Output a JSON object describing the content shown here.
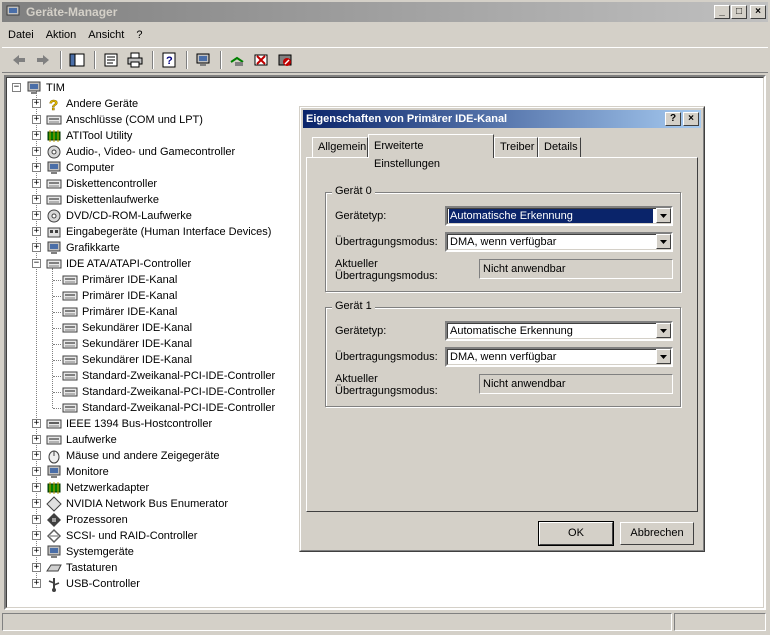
{
  "window": {
    "title": "Geräte-Manager",
    "minimize": "_",
    "maximize": "□",
    "close": "×"
  },
  "menu": [
    "Datei",
    "Aktion",
    "Ansicht",
    "?"
  ],
  "toolbar_icons": [
    "back-arrow-icon",
    "forward-arrow-icon",
    "console-tree-icon",
    "properties-icon",
    "print-icon",
    "help-icon",
    "computer-refresh-icon",
    "scan-hardware-icon",
    "update-driver-icon",
    "uninstall-icon",
    "disable-icon"
  ],
  "tree": {
    "root": "TIM",
    "items": [
      {
        "label": "Andere Geräte",
        "icon": "question-mark-icon",
        "expander": "+"
      },
      {
        "label": "Anschlüsse (COM und LPT)",
        "icon": "port-icon",
        "expander": "+"
      },
      {
        "label": "ATITool Utility",
        "icon": "chip-icon",
        "expander": "+"
      },
      {
        "label": "Audio-, Video- und Gamecontroller",
        "icon": "speaker-icon",
        "expander": "+"
      },
      {
        "label": "Computer",
        "icon": "computer-icon",
        "expander": "+"
      },
      {
        "label": "Diskettencontroller",
        "icon": "disk-controller-icon",
        "expander": "+"
      },
      {
        "label": "Diskettenlaufwerke",
        "icon": "floppy-icon",
        "expander": "+"
      },
      {
        "label": "DVD/CD-ROM-Laufwerke",
        "icon": "cdrom-icon",
        "expander": "+"
      },
      {
        "label": "Eingabegeräte (Human Interface Devices)",
        "icon": "hid-icon",
        "expander": "+"
      },
      {
        "label": "Grafikkarte",
        "icon": "display-icon",
        "expander": "+"
      },
      {
        "label": "IDE ATA/ATAPI-Controller",
        "icon": "ide-controller-icon",
        "expander": "-"
      }
    ],
    "ide_children": [
      "Primärer IDE-Kanal",
      "Primärer IDE-Kanal",
      "Primärer IDE-Kanal",
      "Sekundärer IDE-Kanal",
      "Sekundärer IDE-Kanal",
      "Sekundärer IDE-Kanal",
      "Standard-Zweikanal-PCI-IDE-Controller",
      "Standard-Zweikanal-PCI-IDE-Controller",
      "Standard-Zweikanal-PCI-IDE-Controller"
    ],
    "items_after": [
      {
        "label": "IEEE 1394 Bus-Hostcontroller",
        "icon": "firewire-icon",
        "expander": "+"
      },
      {
        "label": "Laufwerke",
        "icon": "hard-drive-icon",
        "expander": "+"
      },
      {
        "label": "Mäuse und andere Zeigegeräte",
        "icon": "mouse-icon",
        "expander": "+"
      },
      {
        "label": "Monitore",
        "icon": "monitor-icon",
        "expander": "+"
      },
      {
        "label": "Netzwerkadapter",
        "icon": "network-adapter-icon",
        "expander": "+"
      },
      {
        "label": "NVIDIA Network Bus Enumerator",
        "icon": "diamond-icon",
        "expander": "+"
      },
      {
        "label": "Prozessoren",
        "icon": "processor-icon",
        "expander": "+"
      },
      {
        "label": "SCSI- und RAID-Controller",
        "icon": "scsi-icon",
        "expander": "+"
      },
      {
        "label": "Systemgeräte",
        "icon": "system-device-icon",
        "expander": "+"
      },
      {
        "label": "Tastaturen",
        "icon": "keyboard-icon",
        "expander": "+"
      },
      {
        "label": "USB-Controller",
        "icon": "usb-icon",
        "expander": "+"
      }
    ]
  },
  "dialog": {
    "title": "Eigenschaften von Primärer IDE-Kanal",
    "help_btn": "?",
    "close_btn": "×",
    "tabs": [
      "Allgemein",
      "Erweiterte Einstellungen",
      "Treiber",
      "Details"
    ],
    "active_tab": "Erweiterte Einstellungen",
    "device0": {
      "legend": "Gerät 0",
      "type_label": "Gerätetyp:",
      "type_value": "Automatische Erkennung",
      "mode_label": "Übertragungsmodus:",
      "mode_value": "DMA, wenn verfügbar",
      "current_label_1": "Aktueller",
      "current_label_2": "Übertragungsmodus:",
      "current_value": "Nicht anwendbar"
    },
    "device1": {
      "legend": "Gerät 1",
      "type_label": "Gerätetyp:",
      "type_value": "Automatische Erkennung",
      "mode_label": "Übertragungsmodus:",
      "mode_value": "DMA, wenn verfügbar",
      "current_label_1": "Aktueller",
      "current_label_2": "Übertragungsmodus:",
      "current_value": "Nicht anwendbar"
    },
    "ok": "OK",
    "cancel": "Abbrechen"
  },
  "colors": {
    "dialog_title_active": "#0a246a",
    "main_title_inactive": "#808080",
    "face": "#d4d0c8"
  }
}
